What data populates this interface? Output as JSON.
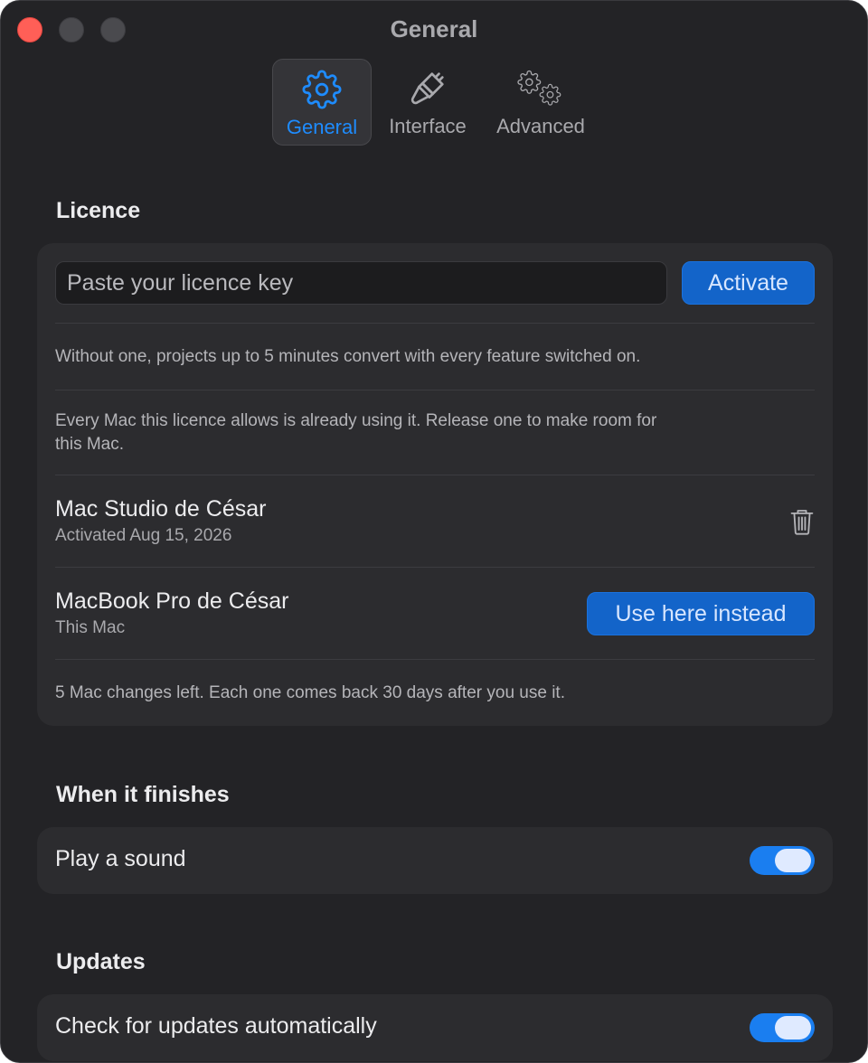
{
  "window": {
    "title": "General"
  },
  "toolbar": {
    "tabs": [
      {
        "label": "General",
        "icon": "gear-icon",
        "active": true
      },
      {
        "label": "Interface",
        "icon": "paintbrush-icon",
        "active": false
      },
      {
        "label": "Advanced",
        "icon": "gears-icon",
        "active": false
      }
    ]
  },
  "licence": {
    "heading": "Licence",
    "placeholder": "Paste your licence key",
    "activate_label": "Activate",
    "note_trial": "Without one, projects up to 5 minutes convert with every feature switched on.",
    "note_limit_line1": "Every Mac this licence allows is already using it. Release one to make room for",
    "note_limit_line2": "this Mac.",
    "devices": [
      {
        "name": "Mac Studio de César",
        "subtitle": "Activated Aug 15, 2026",
        "action": "trash-icon"
      },
      {
        "name": "MacBook Pro de César",
        "subtitle": "This Mac",
        "action_label": "Use here instead"
      }
    ],
    "changes_note": "5 Mac changes left. Each one comes back 30 days after you use it."
  },
  "finish": {
    "heading": "When it finishes",
    "play_sound_label": "Play a sound",
    "play_sound_on": true
  },
  "updates": {
    "heading": "Updates",
    "auto_check_label": "Check for updates automatically",
    "auto_check_on": true
  },
  "colors": {
    "accent": "#1e8cff",
    "button_blue": "#1364c9",
    "toggle_on": "#1a7ef0",
    "window_bg": "#232326",
    "card_bg": "#2c2c2f"
  }
}
